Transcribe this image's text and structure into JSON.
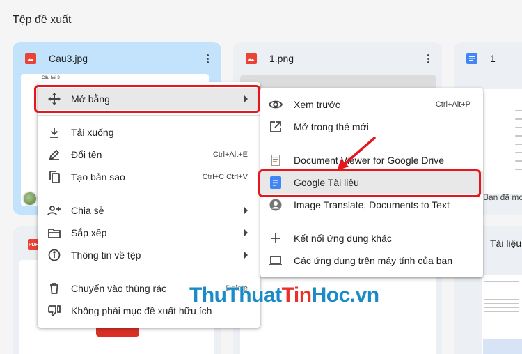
{
  "section_title": "Tệp đề xuất",
  "cards": {
    "card1": {
      "name": "Cau3.jpg",
      "thumb_heading": "Câu hỏi 3"
    },
    "card2": {
      "name": "1.png"
    },
    "card3": {
      "name": "1",
      "snippet": "Bạn đã mo"
    },
    "card6": {
      "name": "Tài liệu"
    }
  },
  "context_menu": {
    "open_with": "Mở bằng",
    "download": "Tải xuống",
    "rename": "Đổi tên",
    "rename_shortcut": "Ctrl+Alt+E",
    "copy": "Tạo bản sao",
    "copy_shortcut": "Ctrl+C Ctrl+V",
    "share": "Chia sẻ",
    "organize": "Sắp xếp",
    "file_info": "Thông tin về tệp",
    "trash": "Chuyển vào thùng rác",
    "trash_shortcut": "Delete",
    "not_helpful": "Không phải mục đề xuất hữu ích"
  },
  "submenu": {
    "preview": "Xem trước",
    "preview_shortcut": "Ctrl+Alt+P",
    "new_tab": "Mở trong thẻ mới",
    "doc_viewer": "Document Viewer for Google Drive",
    "google_docs": "Google Tài liệu",
    "image_translate": "Image Translate, Documents to Text",
    "connect_apps": "Kết nối ứng dụng khác",
    "computer_apps": "Các ứng dụng trên máy tính của bạn"
  },
  "watermark": {
    "part1": "Thu",
    "part2": "Thuat",
    "part3": "Tin",
    "part4": "Hoc",
    "part5": ".vn"
  },
  "colors": {
    "accent_red": "#e6161d",
    "selected_card": "#c2e3fb",
    "docs_blue": "#4285f4"
  }
}
